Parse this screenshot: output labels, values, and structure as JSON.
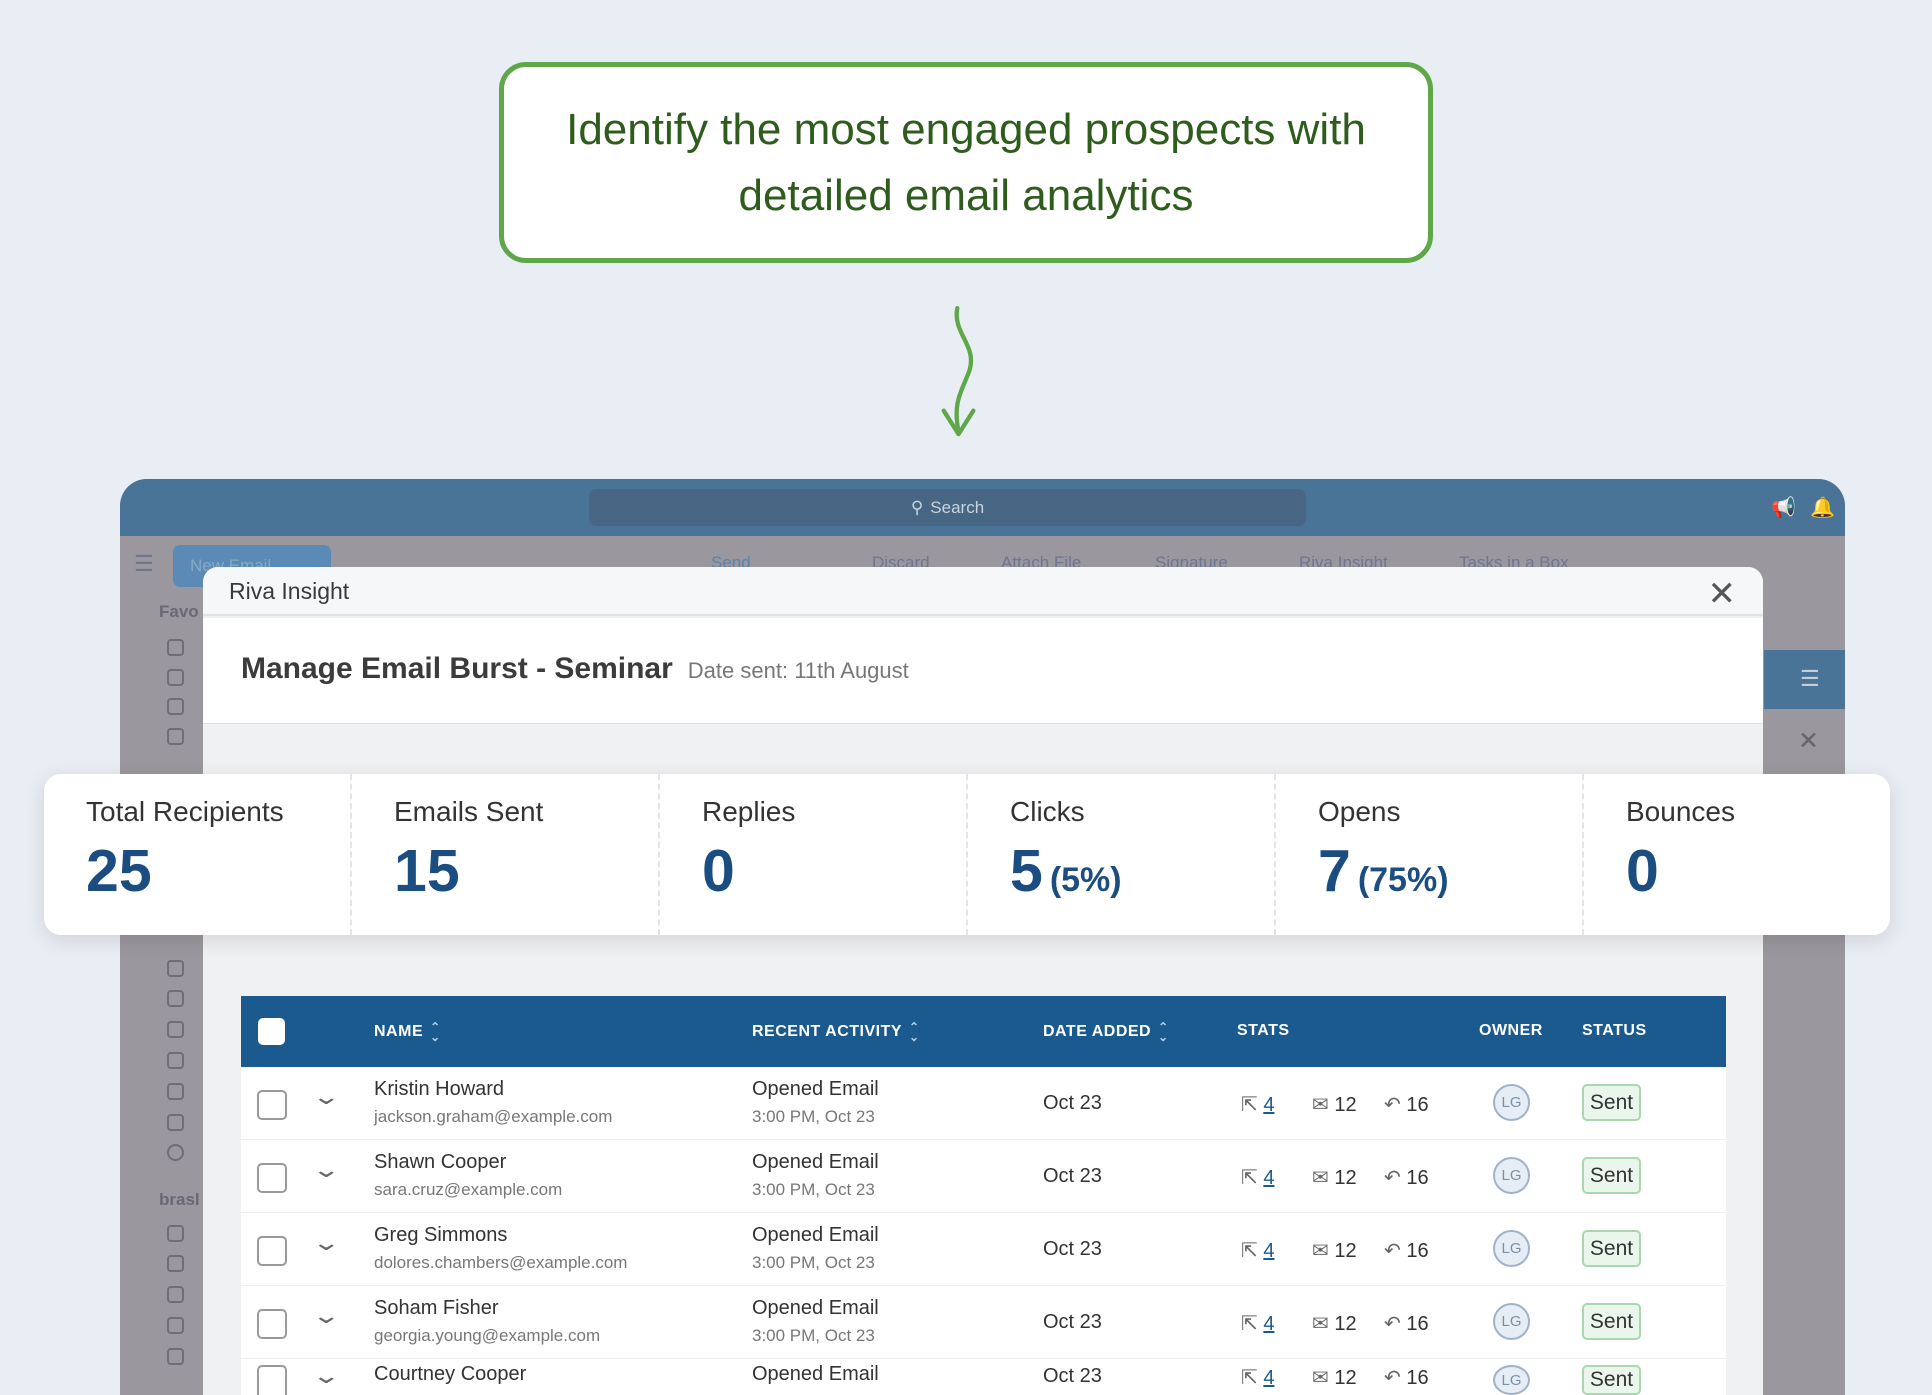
{
  "callout": {
    "text": "Identify the most engaged prospects with detailed email analytics"
  },
  "colors": {
    "accent": "#1b5a8e",
    "callout_border": "#5fa84a",
    "topbar": "#4a7398"
  },
  "app": {
    "search_placeholder": "Search",
    "new_email": "New Email",
    "toolbar": [
      "Send",
      "Discard",
      "Attach File",
      "Signature",
      "Riva Insight",
      "Tasks in a Box"
    ],
    "sidebar": {
      "favorites": "Favo",
      "group2": "brasl"
    }
  },
  "modal": {
    "title": "Riva Insight",
    "heading": "Manage Email Burst - Seminar",
    "date_sent": "Date sent: 11th August"
  },
  "stats": [
    {
      "label": "Total Recipients",
      "value": "25",
      "pct": ""
    },
    {
      "label": "Emails Sent",
      "value": "15",
      "pct": ""
    },
    {
      "label": "Replies",
      "value": "0",
      "pct": ""
    },
    {
      "label": "Clicks",
      "value": "5",
      "pct": "(5%)"
    },
    {
      "label": "Opens",
      "value": "7",
      "pct": "(75%)"
    },
    {
      "label": "Bounces",
      "value": "0",
      "pct": ""
    }
  ],
  "table": {
    "headers": {
      "name": "NAME",
      "activity": "RECENT ACTIVITY",
      "date": "DATE ADDED",
      "stats": "STATS",
      "owner": "OWNER",
      "status": "STATUS"
    },
    "rows": [
      {
        "name": "Kristin Howard",
        "email": "jackson.graham@example.com",
        "activity": "Opened Email",
        "activity_time": "3:00 PM, Oct 23",
        "date": "Oct 23",
        "clicks": "4",
        "opens": "12",
        "replies": "16",
        "owner": "LG",
        "status": "Sent"
      },
      {
        "name": "Shawn Cooper",
        "email": "sara.cruz@example.com",
        "activity": "Opened Email",
        "activity_time": "3:00 PM, Oct 23",
        "date": "Oct 23",
        "clicks": "4",
        "opens": "12",
        "replies": "16",
        "owner": "LG",
        "status": "Sent"
      },
      {
        "name": "Greg Simmons",
        "email": "dolores.chambers@example.com",
        "activity": "Opened Email",
        "activity_time": "3:00 PM, Oct 23",
        "date": "Oct 23",
        "clicks": "4",
        "opens": "12",
        "replies": "16",
        "owner": "LG",
        "status": "Sent"
      },
      {
        "name": "Soham Fisher",
        "email": "georgia.young@example.com",
        "activity": "Opened Email",
        "activity_time": "3:00 PM, Oct 23",
        "date": "Oct 23",
        "clicks": "4",
        "opens": "12",
        "replies": "16",
        "owner": "LG",
        "status": "Sent"
      },
      {
        "name": "Courtney Cooper",
        "email": "",
        "activity": "Opened Email",
        "activity_time": "",
        "date": "Oct 23",
        "clicks": "4",
        "opens": "12",
        "replies": "16",
        "owner": "LG",
        "status": "Sent"
      }
    ]
  }
}
